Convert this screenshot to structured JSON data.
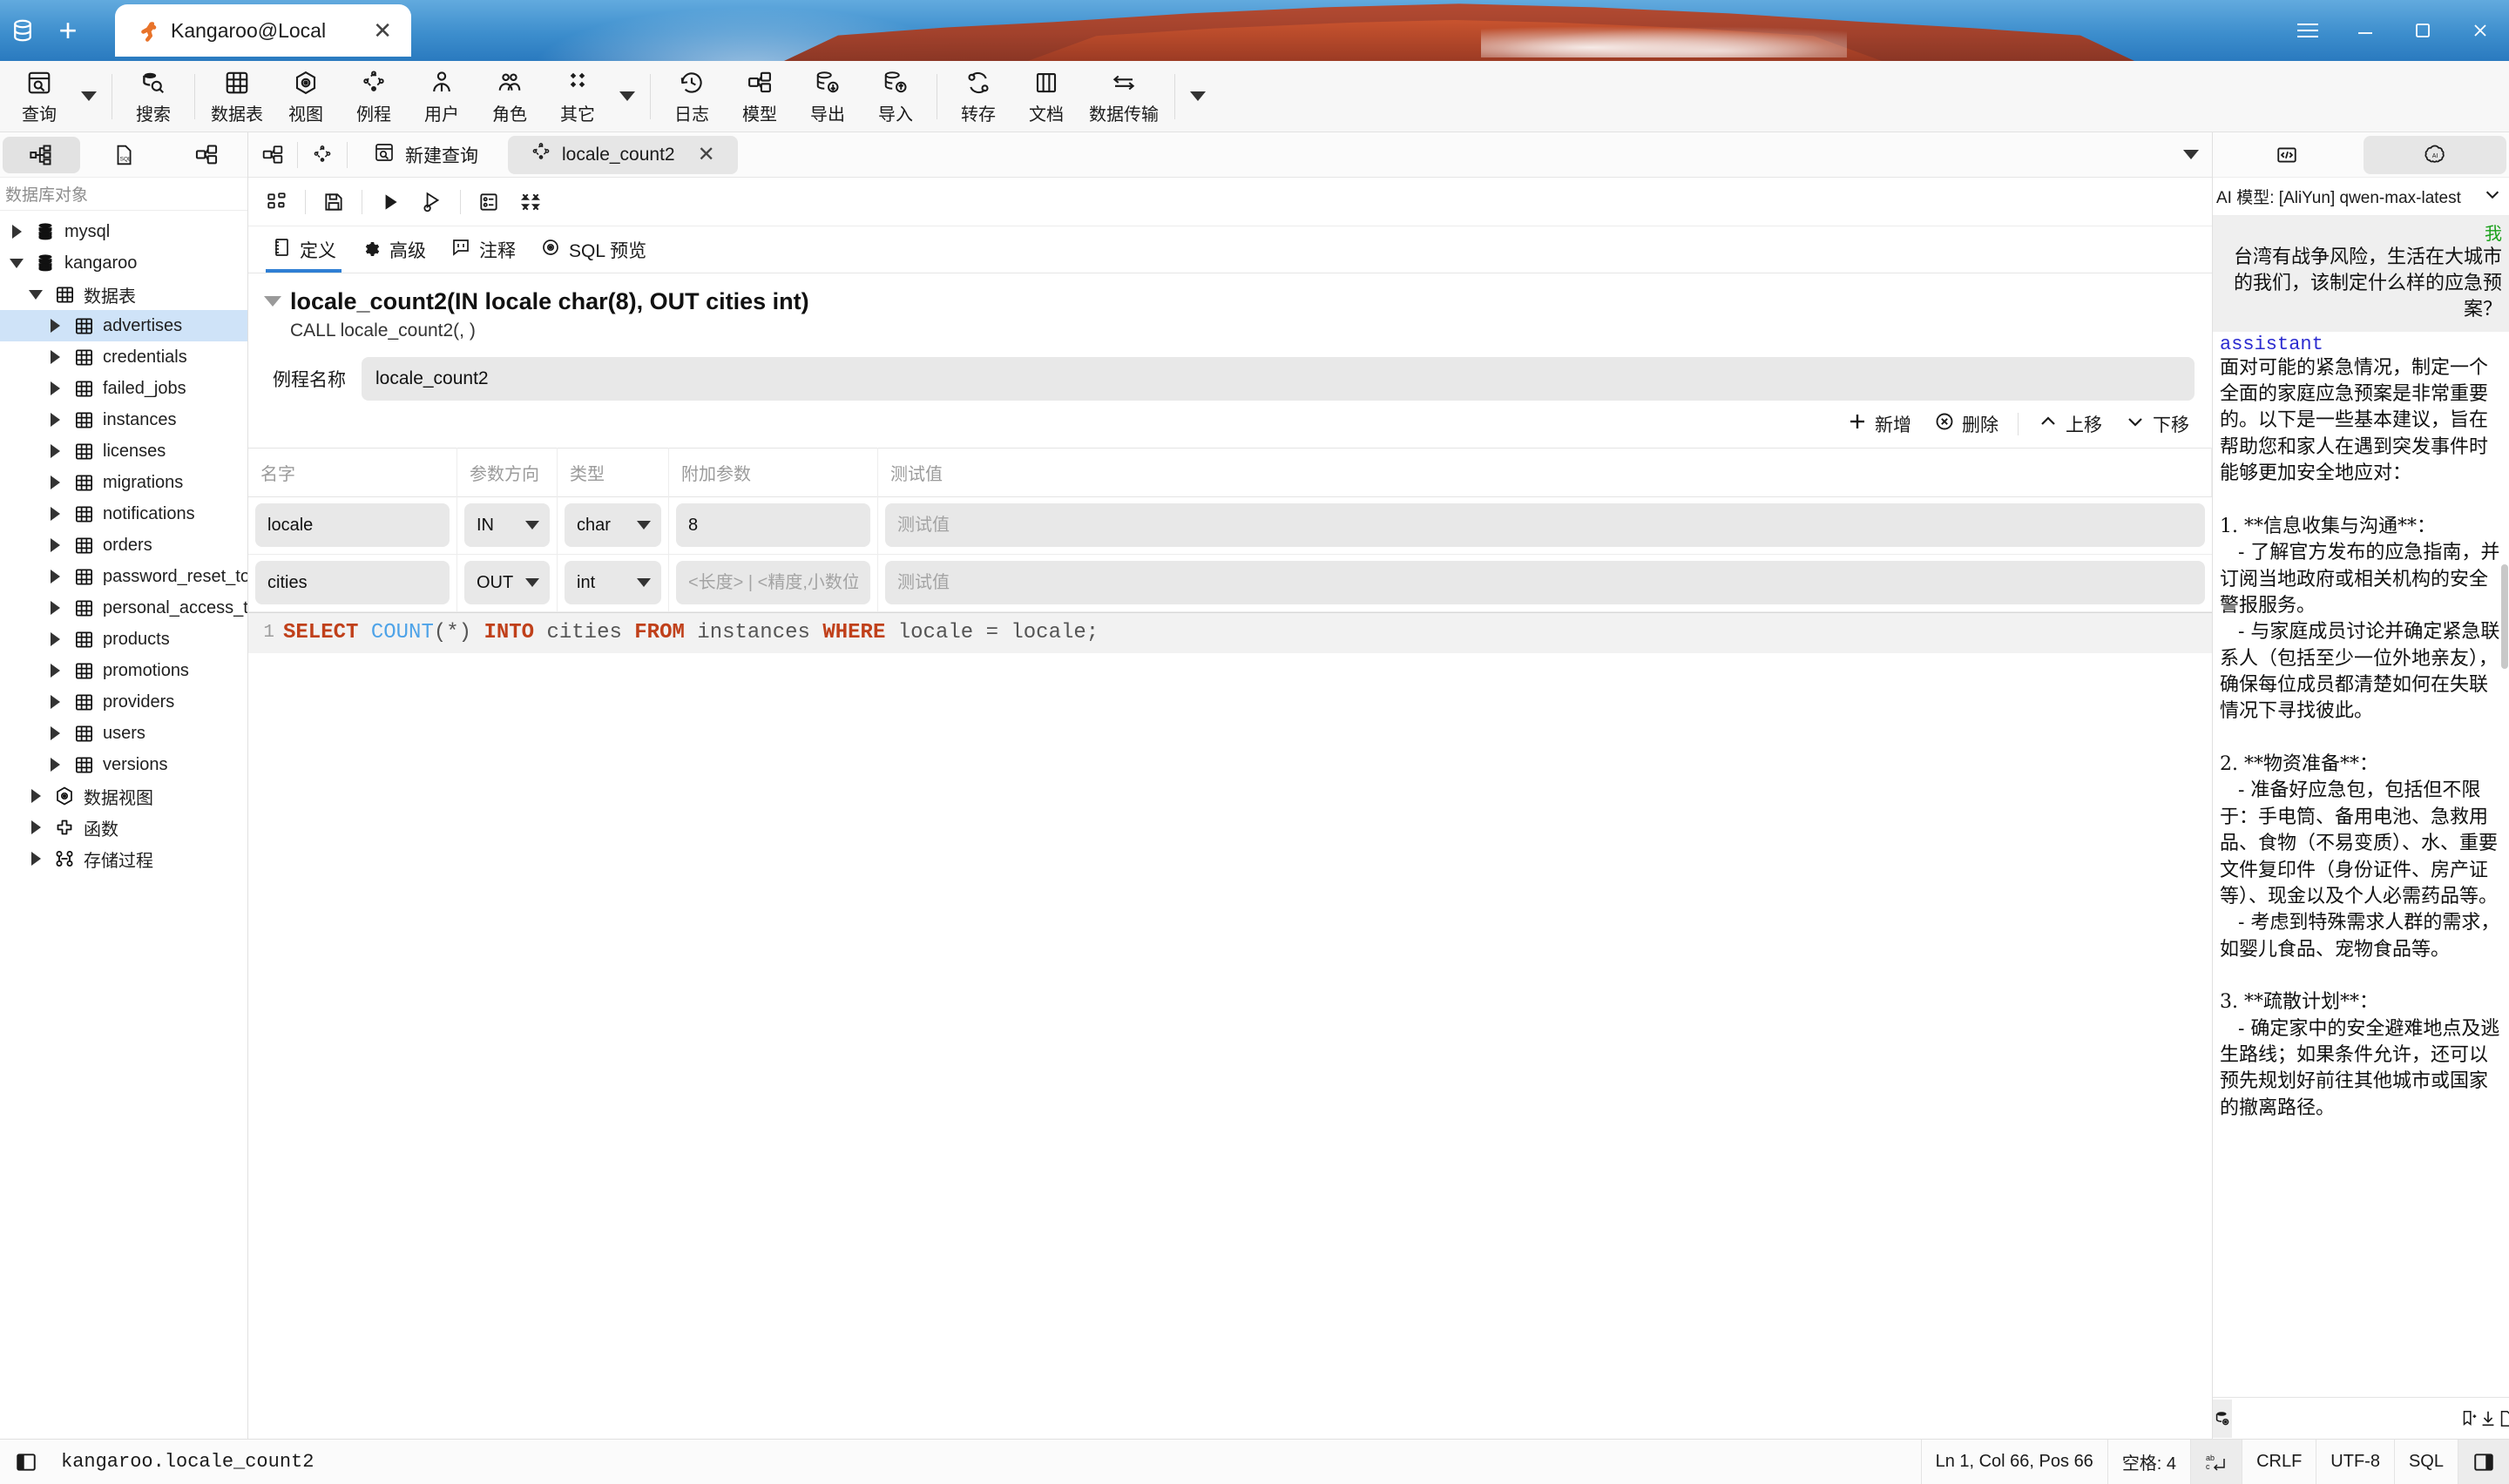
{
  "titlebar": {
    "new_tab_label": "+",
    "connection_tab": "Kangaroo@Local",
    "close_label": "✕",
    "menu_icon": "hamburger-icon",
    "minimize_icon": "minimize-icon",
    "maximize_icon": "maximize-icon",
    "window_close_icon": "close-icon"
  },
  "ribbon": {
    "items": [
      {
        "label": "查询",
        "icon": "query-icon",
        "name": "query"
      },
      {
        "label": "搜索",
        "icon": "search-db-icon",
        "name": "search"
      },
      {
        "label": "数据表",
        "icon": "table-icon",
        "name": "tables"
      },
      {
        "label": "视图",
        "icon": "view-icon",
        "name": "views"
      },
      {
        "label": "例程",
        "icon": "routine-icon",
        "name": "routines"
      },
      {
        "label": "用户",
        "icon": "user-icon",
        "name": "users"
      },
      {
        "label": "角色",
        "icon": "role-icon",
        "name": "roles"
      },
      {
        "label": "其它",
        "icon": "other-icon",
        "name": "other"
      },
      {
        "label": "日志",
        "icon": "log-icon",
        "name": "log"
      },
      {
        "label": "模型",
        "icon": "model-icon",
        "name": "model"
      },
      {
        "label": "导出",
        "icon": "export-icon",
        "name": "export"
      },
      {
        "label": "导入",
        "icon": "import-icon",
        "name": "import"
      },
      {
        "label": "转存",
        "icon": "dump-icon",
        "name": "dump"
      },
      {
        "label": "文档",
        "icon": "doc-icon",
        "name": "doc"
      },
      {
        "label": "数据传输",
        "icon": "transfer-icon",
        "name": "transfer"
      }
    ]
  },
  "sidebar": {
    "tabs": [
      {
        "name": "objects-tab",
        "icon": "tree-icon",
        "active": true
      },
      {
        "name": "sql-files-tab",
        "icon": "sql-file-icon",
        "active": false
      },
      {
        "name": "model-tab",
        "icon": "model-icon",
        "active": false
      }
    ],
    "title": "数据库对象",
    "tree": [
      {
        "label": "mysql",
        "icon": "database-icon",
        "depth": 0,
        "state": "collapsed",
        "selected": false
      },
      {
        "label": "kangaroo",
        "icon": "database-icon",
        "depth": 0,
        "state": "expanded",
        "selected": false
      },
      {
        "label": "数据表",
        "icon": "table-icon",
        "depth": 1,
        "state": "expanded",
        "selected": false
      },
      {
        "label": "advertises",
        "icon": "table-icon",
        "depth": 2,
        "state": "collapsed",
        "selected": true
      },
      {
        "label": "credentials",
        "icon": "table-icon",
        "depth": 2,
        "state": "collapsed",
        "selected": false
      },
      {
        "label": "failed_jobs",
        "icon": "table-icon",
        "depth": 2,
        "state": "collapsed",
        "selected": false
      },
      {
        "label": "instances",
        "icon": "table-icon",
        "depth": 2,
        "state": "collapsed",
        "selected": false
      },
      {
        "label": "licenses",
        "icon": "table-icon",
        "depth": 2,
        "state": "collapsed",
        "selected": false
      },
      {
        "label": "migrations",
        "icon": "table-icon",
        "depth": 2,
        "state": "collapsed",
        "selected": false
      },
      {
        "label": "notifications",
        "icon": "table-icon",
        "depth": 2,
        "state": "collapsed",
        "selected": false
      },
      {
        "label": "orders",
        "icon": "table-icon",
        "depth": 2,
        "state": "collapsed",
        "selected": false
      },
      {
        "label": "password_reset_tokens",
        "icon": "table-icon",
        "depth": 2,
        "state": "collapsed",
        "selected": false
      },
      {
        "label": "personal_access_tokens",
        "icon": "table-icon",
        "depth": 2,
        "state": "collapsed",
        "selected": false
      },
      {
        "label": "products",
        "icon": "table-icon",
        "depth": 2,
        "state": "collapsed",
        "selected": false
      },
      {
        "label": "promotions",
        "icon": "table-icon",
        "depth": 2,
        "state": "collapsed",
        "selected": false
      },
      {
        "label": "providers",
        "icon": "table-icon",
        "depth": 2,
        "state": "collapsed",
        "selected": false
      },
      {
        "label": "users",
        "icon": "table-icon",
        "depth": 2,
        "state": "collapsed",
        "selected": false
      },
      {
        "label": "versions",
        "icon": "table-icon",
        "depth": 2,
        "state": "collapsed",
        "selected": false
      },
      {
        "label": "数据视图",
        "icon": "view-icon",
        "depth": 1,
        "state": "collapsed",
        "selected": false
      },
      {
        "label": "函数",
        "icon": "function-icon",
        "depth": 1,
        "state": "collapsed",
        "selected": false
      },
      {
        "label": "存储过程",
        "icon": "procedure-icon",
        "depth": 1,
        "state": "collapsed",
        "selected": false
      }
    ]
  },
  "editor": {
    "tabs": [
      {
        "label": "新建查询",
        "icon": "query-icon",
        "active": false,
        "closable": false
      },
      {
        "label": "locale_count2",
        "icon": "routine-icon",
        "active": true,
        "closable": true
      }
    ],
    "tab_close": "✕",
    "toolbar_icons": [
      "structure-icon",
      "save-icon",
      "run-icon",
      "run-config-icon",
      "result-icon",
      "collapse-icon"
    ],
    "subtabs": [
      {
        "label": "定义",
        "icon": "definition-icon",
        "active": true
      },
      {
        "label": "高级",
        "icon": "gear-icon",
        "active": false
      },
      {
        "label": "注释",
        "icon": "comment-icon",
        "active": false
      },
      {
        "label": "SQL 预览",
        "icon": "eye-icon",
        "active": false
      }
    ],
    "procedure_title": "locale_count2(IN locale char(8), OUT cities int)",
    "procedure_call": "CALL locale_count2(, )",
    "name_label": "例程名称",
    "name_value": "locale_count2",
    "actions": [
      {
        "label": "新增",
        "icon": "plus-icon",
        "name": "add-param-button"
      },
      {
        "label": "删除",
        "icon": "delete-icon",
        "name": "delete-param-button"
      },
      {
        "label": "上移",
        "icon": "move-up-icon",
        "name": "move-up-button"
      },
      {
        "label": "下移",
        "icon": "move-down-icon",
        "name": "move-down-button"
      }
    ],
    "grid_headers": [
      "名字",
      "参数方向",
      "类型",
      "附加参数",
      "测试值"
    ],
    "params": [
      {
        "name": "locale",
        "direction": "IN",
        "type": "char",
        "extra": "8",
        "extra_placeholder": "",
        "test": "",
        "test_placeholder": "测试值"
      },
      {
        "name": "cities",
        "direction": "OUT",
        "type": "int",
        "extra": "",
        "extra_placeholder": "<长度> | <精度,小数位> | <枚...",
        "test": "",
        "test_placeholder": "测试值"
      }
    ],
    "sql": {
      "line_number": "1",
      "tokens": [
        {
          "t": "SELECT",
          "c": "kw"
        },
        {
          "t": " ",
          "c": "pl"
        },
        {
          "t": "COUNT",
          "c": "fn"
        },
        {
          "t": "(*) ",
          "c": "pl"
        },
        {
          "t": "INTO",
          "c": "kw"
        },
        {
          "t": " cities ",
          "c": "pl"
        },
        {
          "t": "FROM",
          "c": "kw"
        },
        {
          "t": " instances ",
          "c": "pl"
        },
        {
          "t": "WHERE",
          "c": "kw"
        },
        {
          "t": " locale = locale;",
          "c": "pl"
        }
      ]
    }
  },
  "ai_panel": {
    "tabs": [
      {
        "name": "code-tab",
        "icon": "code-icon",
        "active": false
      },
      {
        "name": "ai-tab",
        "icon": "ai-icon",
        "active": true
      }
    ],
    "model_label": "AI 模型: [AliYun] qwen-max-latest",
    "chevron": "⌄",
    "user_role": "我",
    "user_message": "台湾有战争风险，生活在大城市的我们，该制定什么样的应急预案？",
    "assistant_role": "assistant",
    "assistant_message": "面对可能的紧急情况，制定一个全面的家庭应急预案是非常重要的。以下是一些基本建议，旨在帮助您和家人在遇到突发事件时能够更加安全地应对：\n\n1. **信息收集与沟通**：\n   - 了解官方发布的应急指南，并订阅当地政府或相关机构的安全警报服务。\n   - 与家庭成员讨论并确定紧急联系人（包括至少一位外地亲友），确保每位成员都清楚如何在失联情况下寻找彼此。\n\n2. **物资准备**：\n   - 准备好应急包，包括但不限于：手电筒、备用电池、急救用品、食物（不易变质）、水、重要文件复印件（身份证件、房产证等）、现金以及个人必需药品等。\n   - 考虑到特殊需求人群的需求，如婴儿食品、宠物食品等。\n\n3. **疏散计划**：\n   - 确定家中的安全避难地点及逃生路线；如果条件允许，还可以预先规划好前往其他城市或国家的撤离路径。",
    "input_placeholder": "",
    "input_icons": [
      "db-context-icon",
      "bookmark-add-icon",
      "download-icon",
      "new-chat-icon",
      "send-icon"
    ]
  },
  "statusbar": {
    "panel_icon": "left-panel-icon",
    "path": "kangaroo.locale_count2",
    "cells": [
      {
        "label": "Ln 1, Col 66, Pos 66",
        "name": "cursor-position",
        "hl": false
      },
      {
        "label": "空格: 4",
        "name": "indent-setting",
        "hl": false
      },
      {
        "label": "",
        "name": "spellcheck-icon",
        "hl": true
      },
      {
        "label": "CRLF",
        "name": "line-ending",
        "hl": false
      },
      {
        "label": "UTF-8",
        "name": "encoding",
        "hl": false
      },
      {
        "label": "SQL",
        "name": "language-mode",
        "hl": false
      }
    ],
    "right_panel_icon": "right-panel-icon"
  }
}
